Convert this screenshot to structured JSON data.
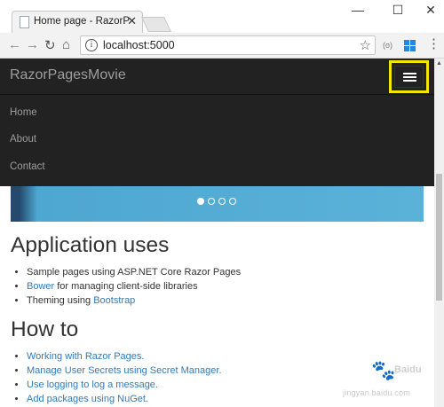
{
  "browser": {
    "tab_title": "Home page - RazorPages",
    "tab_close": "✕",
    "url": "localhost:5000",
    "window_controls": {
      "minimize": "—",
      "maximize": "☐",
      "close": "✕"
    },
    "nav_icons": {
      "back": "←",
      "forward": "→",
      "reload": "↻",
      "home": "⌂"
    },
    "info_icon": "i",
    "star_icon": "☆",
    "extension_label": "(o)",
    "menu_icon": "⋮"
  },
  "navbar": {
    "brand": "RazorPagesMovie",
    "links": [
      "Home",
      "About",
      "Contact"
    ]
  },
  "carousel": {
    "slides": 4,
    "active_index": 0
  },
  "sections": {
    "application_uses": {
      "heading": "Application uses",
      "item1": "Sample pages using ASP.NET Core Razor Pages",
      "item2_link": "Bower",
      "item2_text": " for managing client-side libraries",
      "item3_text": "Theming using ",
      "item3_link": "Bootstrap"
    },
    "how_to": {
      "heading": "How to",
      "items": [
        "Working with Razor Pages.",
        "Manage User Secrets using Secret Manager.",
        "Use logging to log a message.",
        "Add packages using NuGet."
      ]
    }
  },
  "watermark": {
    "brand": "Baidu",
    "text": "jingyan.baidu.com"
  },
  "colors": {
    "navbar_bg": "#222222",
    "nav_text": "#9d9d9d",
    "link": "#337ab7",
    "highlight": "#f5e600",
    "carousel": "#5ab2d9"
  }
}
